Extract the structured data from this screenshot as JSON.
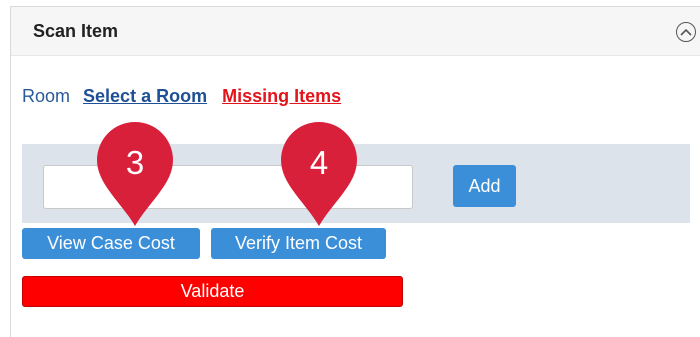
{
  "panel": {
    "title": "Scan Item"
  },
  "room": {
    "label": "Room",
    "select_link": "Select a Room",
    "missing_link": "Missing Items"
  },
  "scan": {
    "add_label": "Add",
    "input_value": ""
  },
  "actions": {
    "view_case_cost": "View Case Cost",
    "verify_item_cost": "Verify Item Cost",
    "validate": "Validate"
  },
  "markers": [
    {
      "number": "3"
    },
    {
      "number": "4"
    }
  ],
  "colors": {
    "button_blue": "#3b8fd9",
    "validate_red": "#ff0000",
    "link_blue": "#1f4f95",
    "missing_red": "#e3141b",
    "marker_red": "#d9203a"
  }
}
